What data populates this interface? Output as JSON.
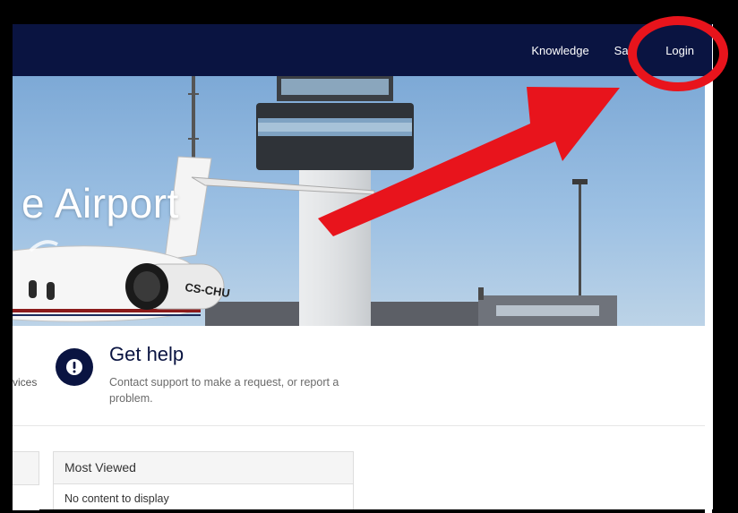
{
  "nav": {
    "items": [
      {
        "label": "Knowledge"
      },
      {
        "label": "Saf"
      },
      {
        "label": "Login"
      }
    ]
  },
  "hero": {
    "title": "e Airport",
    "plane_registration": "CS-CHU"
  },
  "services": {
    "truncated_text": "vices",
    "help": {
      "title": "Get help",
      "description": "Contact support to make a request, or report a problem."
    }
  },
  "most_viewed": {
    "title": "Most Viewed",
    "empty_text": "No content to display"
  },
  "colors": {
    "navbar": "#0a1441",
    "accent_icon": "#0a1441",
    "annotation": "#e8141c"
  }
}
